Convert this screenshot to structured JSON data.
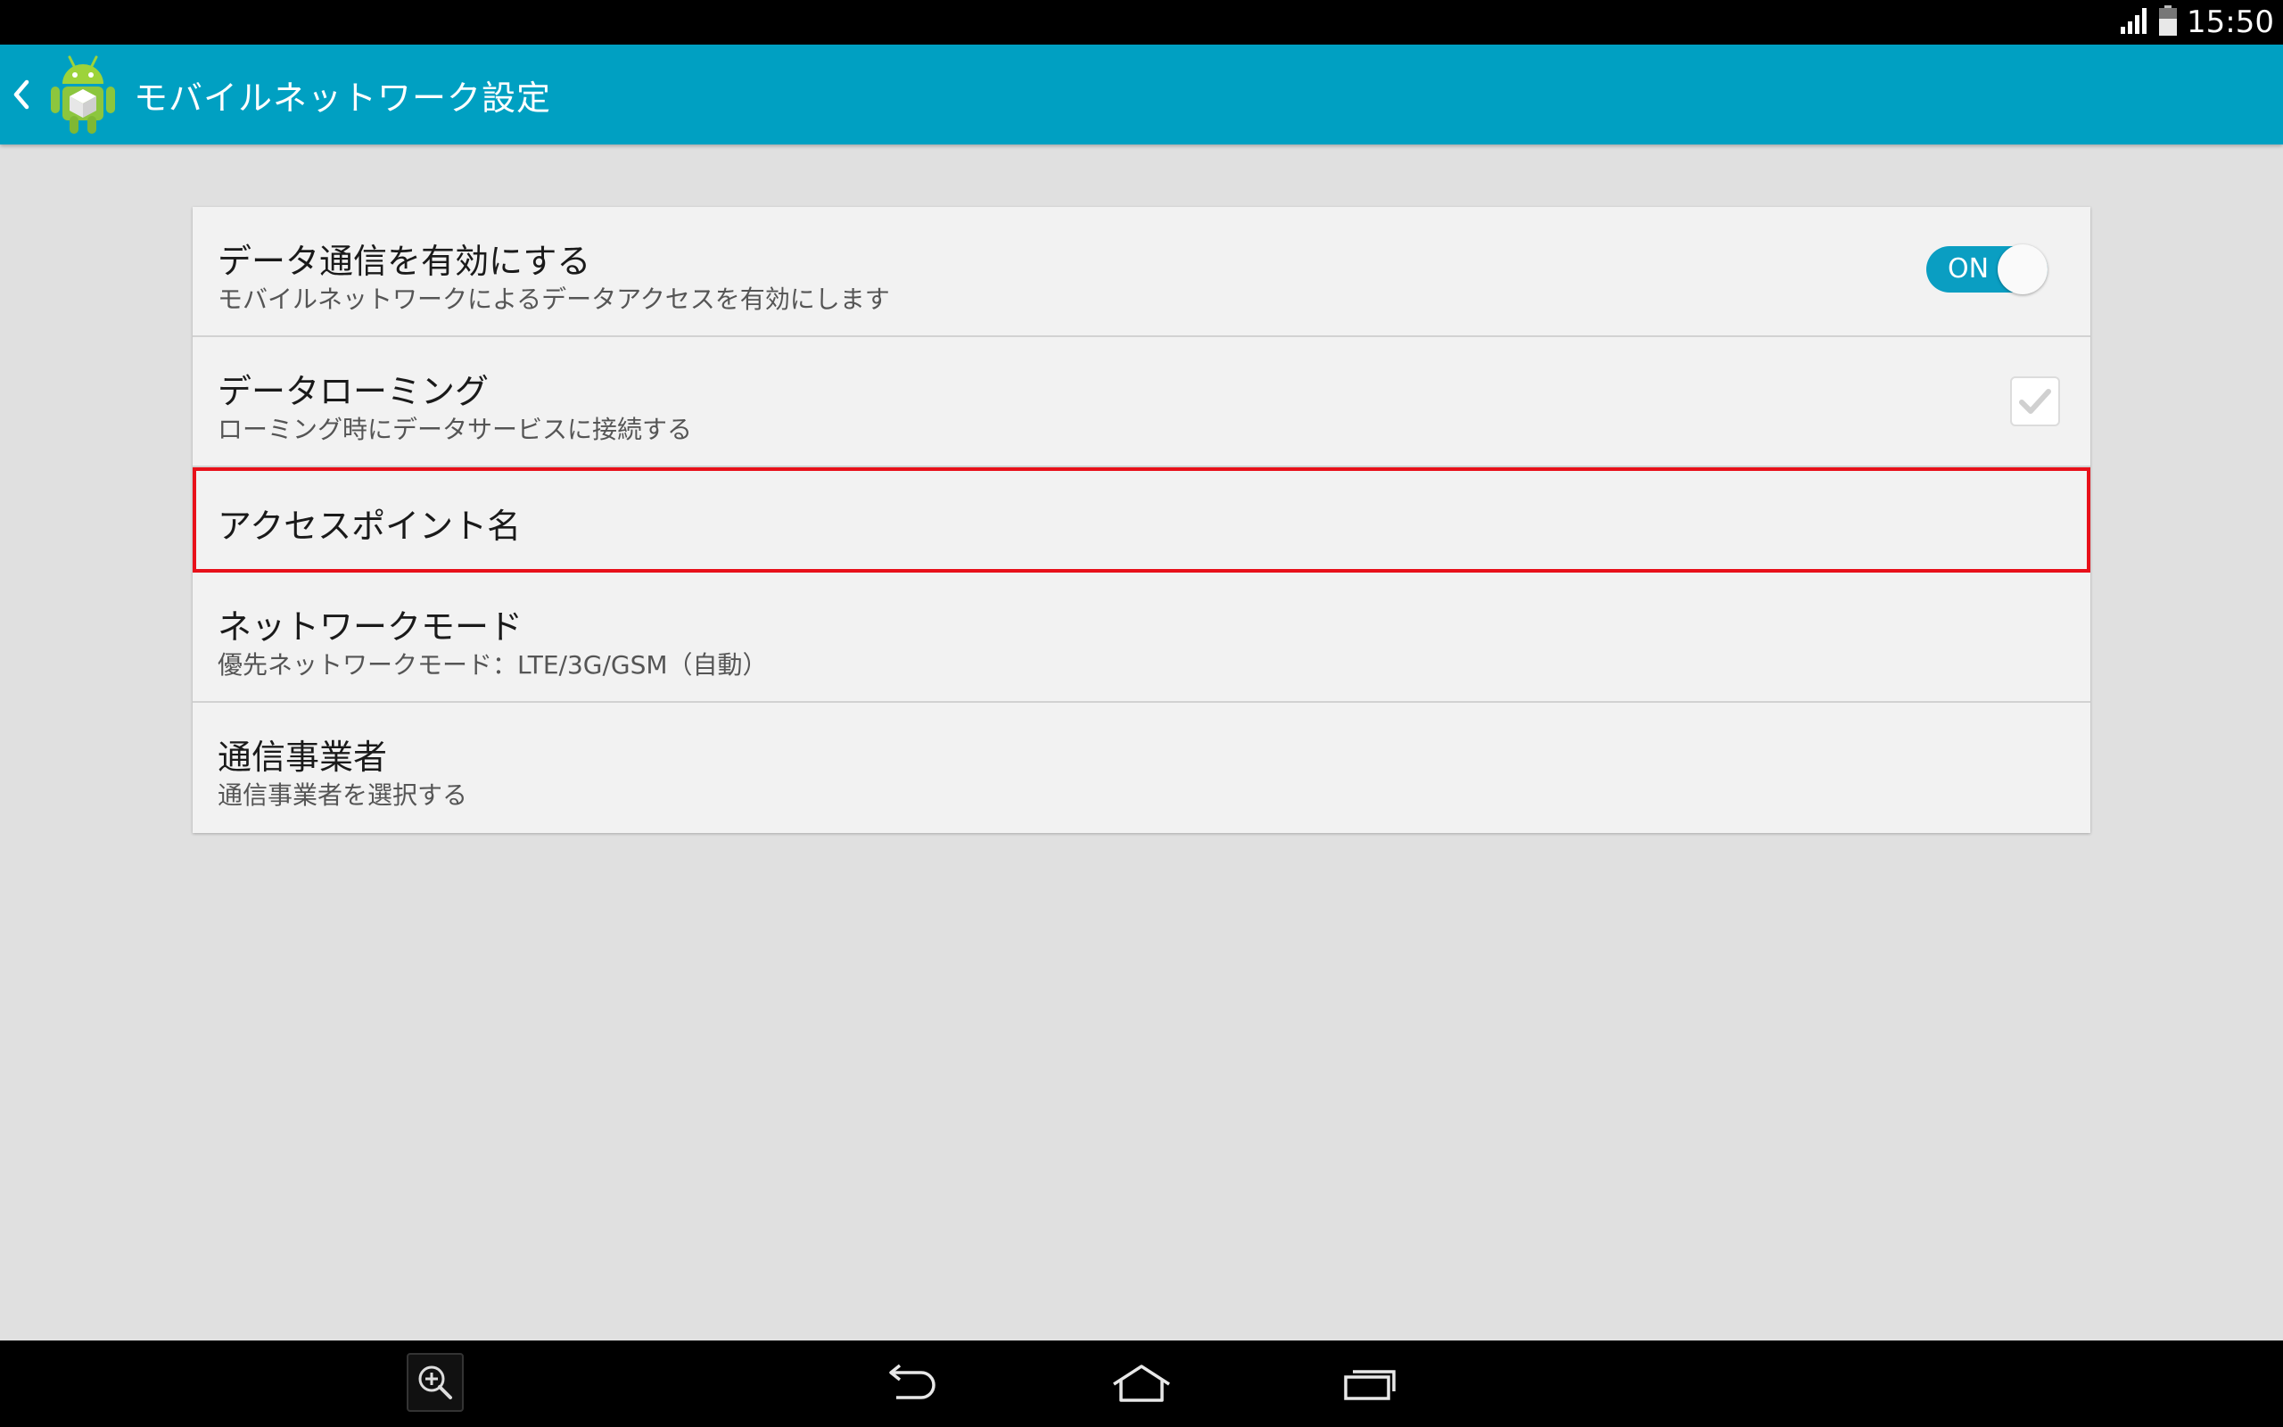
{
  "status_bar": {
    "time": "15:50",
    "icons": [
      "signal-icon",
      "battery-icon"
    ]
  },
  "action_bar": {
    "title": "モバイルネットワーク設定",
    "background": "#00a0c2",
    "icons": [
      "back-caret-icon",
      "android-app-icon"
    ]
  },
  "settings": {
    "items": [
      {
        "title": "データ通信を有効にする",
        "summary": "モバイルネットワークによるデータアクセスを有効にします",
        "control": "toggle",
        "toggle_label": "ON",
        "checked": true
      },
      {
        "title": "データローミング",
        "summary": "ローミング時にデータサービスに接続する",
        "control": "checkbox",
        "checked": true
      },
      {
        "title": "アクセスポイント名",
        "highlighted": true
      },
      {
        "title": "ネットワークモード",
        "summary": "優先ネットワークモード：LTE/3G/GSM（自動）"
      },
      {
        "title": "通信事業者",
        "summary": "通信事業者を選択する"
      }
    ],
    "highlight_color": "#e8101a",
    "accent_color": "#0a9ec2"
  },
  "nav_bar": {
    "buttons": [
      "zoom-icon",
      "back-icon",
      "home-icon",
      "recent-apps-icon"
    ]
  }
}
